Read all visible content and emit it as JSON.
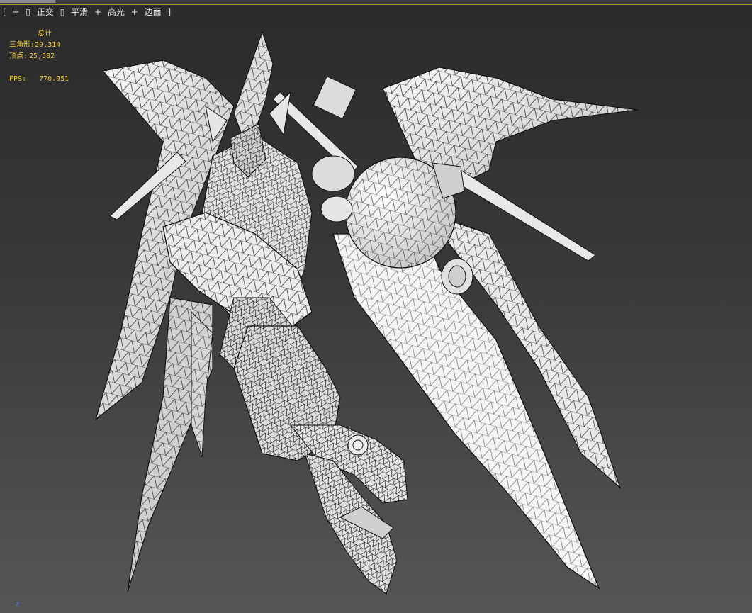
{
  "viewport": {
    "label": {
      "open": "[",
      "plus1": "+",
      "box1": "▯",
      "projection": "正交",
      "box2": "▯",
      "shading": "平滑",
      "plus2": "+",
      "highlights": "高光",
      "plus3": "+",
      "edges": "边面",
      "close": "]"
    },
    "stats": {
      "title": "总计",
      "tris_label": "三角形:",
      "tris_value": "29,314",
      "verts_label": "顶点:",
      "verts_value": "25,582",
      "fps_label": "FPS:",
      "fps_value": "770.951"
    },
    "axis": "z",
    "colors": {
      "stats_text": "#f0c832",
      "label_text": "#e6e6e6",
      "background_top": "#2a2a2a",
      "background_bottom": "#565656",
      "mesh_fill": "#f2f2f2",
      "mesh_wire": "#111111",
      "axis": "#4e74ff"
    }
  }
}
